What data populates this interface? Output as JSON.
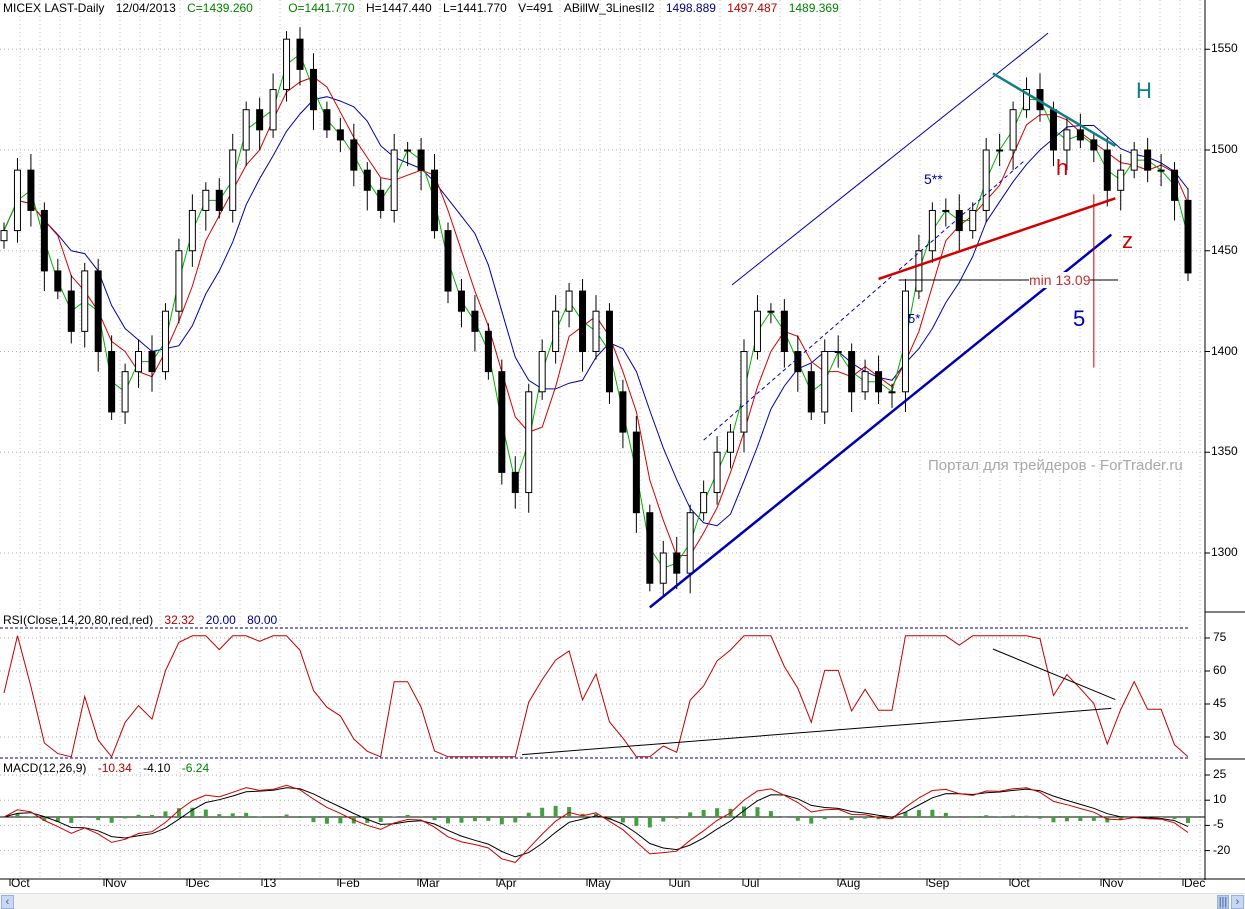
{
  "header": {
    "symbol": "MICEX LAST-Daily",
    "date": "12/04/2013",
    "close": "C=1439.260",
    "open": "O=1441.770",
    "high": "H=1447.440",
    "low": "L=1441.770",
    "volume": "V=491",
    "indicator": "ABillW_3LinesII2",
    "ind_blue": "1498.889",
    "ind_red": "1497.487",
    "ind_green": "1489.369"
  },
  "rsi_header": {
    "name": "RSI(Close,14,20,80,red,red)",
    "value": "32.32",
    "low": "20.00",
    "high": "80.00"
  },
  "macd_header": {
    "name": "MACD(12,26,9)",
    "macd": "-10.34",
    "signal": "-4.10",
    "hist": "-6.24"
  },
  "annotations": {
    "channel_top": "5**",
    "channel_mid": "5*",
    "small_h": "h",
    "big_h": "H",
    "z": "z",
    "five": "5",
    "min_label": "min 13.09",
    "watermark": "Портал для трейдеров - ForTrader.ru"
  },
  "colors": {
    "up": "#ffffff",
    "down": "#000000",
    "ma_green": "#00b000",
    "ma_red": "#d00000",
    "ma_blue": "#0000b0",
    "rsi": "#c00000",
    "teal": "#118080",
    "hist": "#40a040"
  },
  "chart_data": {
    "type": "candlestick",
    "title": "MICEX LAST-Daily",
    "x_labels": [
      "Oct",
      "Nov",
      "Dec",
      "13",
      "Feb",
      "Mar",
      "Apr",
      "May",
      "Jun",
      "Jul",
      "Aug",
      "Sep",
      "Oct",
      "Nov",
      "Dec"
    ],
    "price_ticks": [
      1300,
      1350,
      1400,
      1450,
      1500,
      1550
    ],
    "ylim": [
      1255,
      1575
    ],
    "closes": [
      1460,
      1490,
      1470,
      1440,
      1430,
      1410,
      1440,
      1400,
      1370,
      1390,
      1400,
      1390,
      1420,
      1450,
      1470,
      1480,
      1470,
      1500,
      1520,
      1510,
      1530,
      1555,
      1540,
      1520,
      1510,
      1505,
      1490,
      1480,
      1470,
      1500,
      1500,
      1490,
      1460,
      1430,
      1420,
      1410,
      1390,
      1340,
      1330,
      1380,
      1400,
      1420,
      1430,
      1400,
      1420,
      1380,
      1360,
      1320,
      1285,
      1300,
      1290,
      1320,
      1330,
      1350,
      1360,
      1400,
      1420,
      1420,
      1400,
      1390,
      1370,
      1400,
      1400,
      1380,
      1390,
      1380,
      1380,
      1430,
      1450,
      1470,
      1470,
      1460,
      1470,
      1500,
      1500,
      1520,
      1530,
      1520,
      1500,
      1510,
      1505,
      1500,
      1480,
      1490,
      1500,
      1490,
      1490,
      1475,
      1439
    ],
    "trendlines": [
      {
        "name": "support-5",
        "from": [
          48.0,
          1273
        ],
        "to": [
          82.3,
          1458
        ],
        "color": "#0000b0",
        "style": "thick"
      },
      {
        "name": "channel-5-star-star",
        "from": [
          54.1,
          1433
        ],
        "to": [
          77.6,
          1558
        ],
        "color": "#0000b0",
        "style": "thin"
      },
      {
        "name": "channel-5-star",
        "from": [
          52,
          1356
        ],
        "to": [
          75.9,
          1495
        ],
        "color": "#0000b0",
        "style": "dashed"
      },
      {
        "name": "neckline-red",
        "from": [
          65,
          1436
        ],
        "to": [
          82.6,
          1476
        ],
        "color": "#d00000",
        "style": "thick"
      },
      {
        "name": "resistance-H",
        "from": [
          73.5,
          1538
        ],
        "to": [
          82.6,
          1502
        ],
        "color": "#118080",
        "style": "thick"
      },
      {
        "name": "target-vertical",
        "from": [
          81,
          1478
        ],
        "to": [
          81,
          1392
        ],
        "color": "#d00000",
        "style": "thin"
      },
      {
        "name": "min-level",
        "from": [
          66.5,
          1435.5
        ],
        "to": [
          82.8,
          1435.5
        ],
        "color": "#000000",
        "style": "thin"
      }
    ],
    "rsi": {
      "ticks": [
        30,
        45,
        60,
        75
      ],
      "ylim": [
        20,
        80
      ],
      "lines": [
        {
          "from": [
            73.5,
            70
          ],
          "to": [
            82.6,
            47
          ]
        },
        {
          "from": [
            38.5,
            22
          ],
          "to": [
            82.3,
            43
          ]
        }
      ]
    },
    "macd": {
      "ticks": [
        -20,
        -5,
        10,
        25
      ],
      "ylim": [
        -28,
        30
      ]
    }
  }
}
